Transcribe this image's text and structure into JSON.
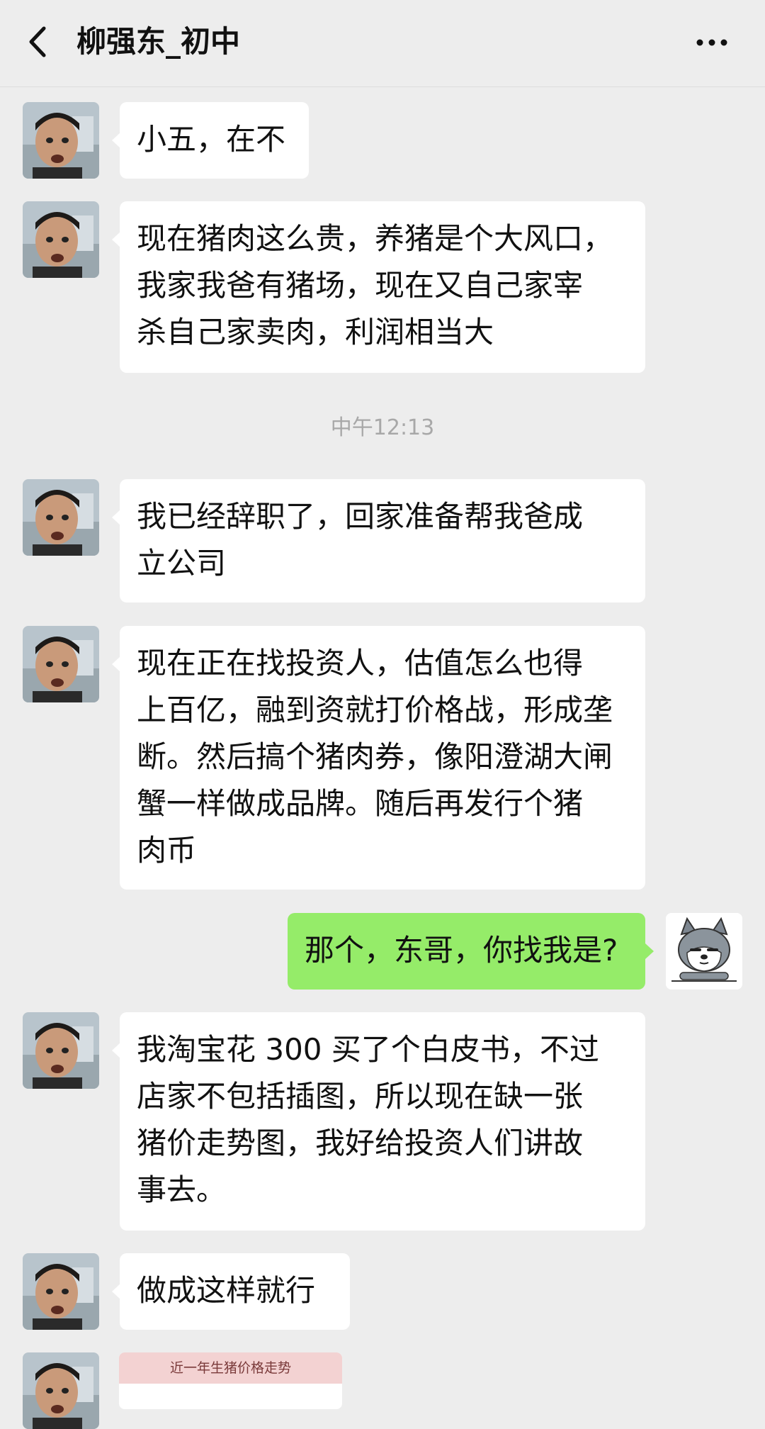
{
  "header": {
    "title": "柳强东_初中"
  },
  "timestamp": "中午12:13",
  "messages": [
    {
      "text": "小五，在不"
    },
    {
      "text": "现在猪肉这么贵，养猪是个大风口，\n我家我爸有猪场，现在又自己家宰\n杀自己家卖肉，利润相当大"
    },
    {
      "text": "我已经辞职了，回家准备帮我爸成\n立公司"
    },
    {
      "text": "现在正在找投资人，估值怎么也得\n上百亿，融到资就打价格战，形成垄\n断。然后搞个猪肉券，像阳澄湖大闸\n蟹一样做成品牌。随后再发行个猪\n肉币"
    },
    {
      "text": "那个，东哥，你找我是?"
    },
    {
      "text": "我淘宝花 300 买了个白皮书，不过\n店家不包括插图，所以现在缺一张\n猪价走势图，我好给投资人们讲故\n事去。"
    },
    {
      "text": "做成这样就行"
    }
  ],
  "image_message": {
    "title": "近一年生猪价格走势"
  },
  "colors": {
    "background": "#ededed",
    "bubble_other": "#ffffff",
    "bubble_me": "#95ec69"
  }
}
